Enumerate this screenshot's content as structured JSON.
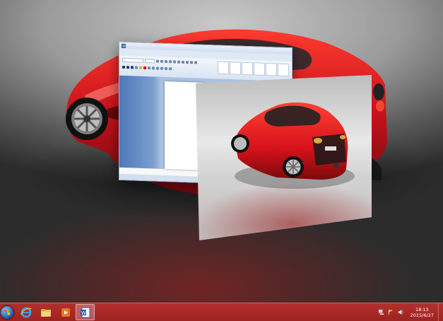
{
  "desktop": {
    "wallpaper": "red-sports-car-wallpaper",
    "mode": "flip-3d"
  },
  "windows": [
    {
      "app": "word",
      "icon": "word-document-icon"
    },
    {
      "app": "photo-viewer",
      "icon": "photo-icon"
    }
  ],
  "taskbar": {
    "start_icon": "windows-start-orb-icon",
    "pinned": [
      {
        "icon": "internet-explorer-icon"
      },
      {
        "icon": "file-explorer-icon"
      },
      {
        "icon": "media-player-icon"
      },
      {
        "icon": "word-document-icon",
        "active": true
      }
    ],
    "tray_icons": [
      "network-icon",
      "flag-icon",
      "volume-icon"
    ],
    "clock_time": "18:13",
    "clock_date": "2015/6/27"
  },
  "colors": {
    "taskbar": "#a8292a",
    "car_red": "#d2141a",
    "word_blue": "#2b579a"
  }
}
